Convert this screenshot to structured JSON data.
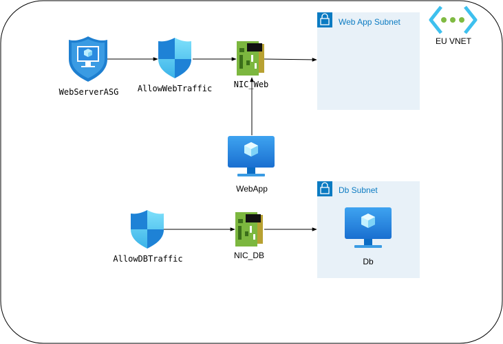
{
  "diagram": {
    "vnet": {
      "label": "EU VNET"
    },
    "subnets": {
      "web": {
        "label": "Web App Subnet"
      },
      "db": {
        "label": "Db Subnet"
      }
    },
    "nodes": {
      "webserver_asg": {
        "label": "WebServerASG",
        "icon": "application-security-group-icon"
      },
      "allow_web": {
        "label": "AllowWebTraffic",
        "icon": "shield-icon"
      },
      "nic_web": {
        "label": "NIC_Web",
        "icon": "network-interface-icon"
      },
      "webapp": {
        "label": "WebApp",
        "icon": "virtual-machine-icon"
      },
      "allow_db": {
        "label": "AllowDBTraffic",
        "icon": "shield-icon"
      },
      "nic_db": {
        "label": "NIC_DB",
        "icon": "network-interface-icon"
      },
      "db": {
        "label": "Db",
        "icon": "virtual-machine-icon"
      }
    },
    "edges": [
      {
        "from": "WebServerASG",
        "to": "AllowWebTraffic"
      },
      {
        "from": "AllowWebTraffic",
        "to": "NIC_Web"
      },
      {
        "from": "NIC_Web",
        "to": "Web App Subnet"
      },
      {
        "from": "WebApp",
        "to": "NIC_Web"
      },
      {
        "from": "AllowDBTraffic",
        "to": "NIC_DB"
      },
      {
        "from": "NIC_DB",
        "to": "Db Subnet"
      }
    ],
    "colors": {
      "subnet_fill": "#e8f1f8",
      "azure_blue": "#0b7bc2",
      "nic_green": "#7cb73f",
      "vnet_cyan": "#3ec0ee",
      "vnet_green": "#7fba42"
    }
  }
}
